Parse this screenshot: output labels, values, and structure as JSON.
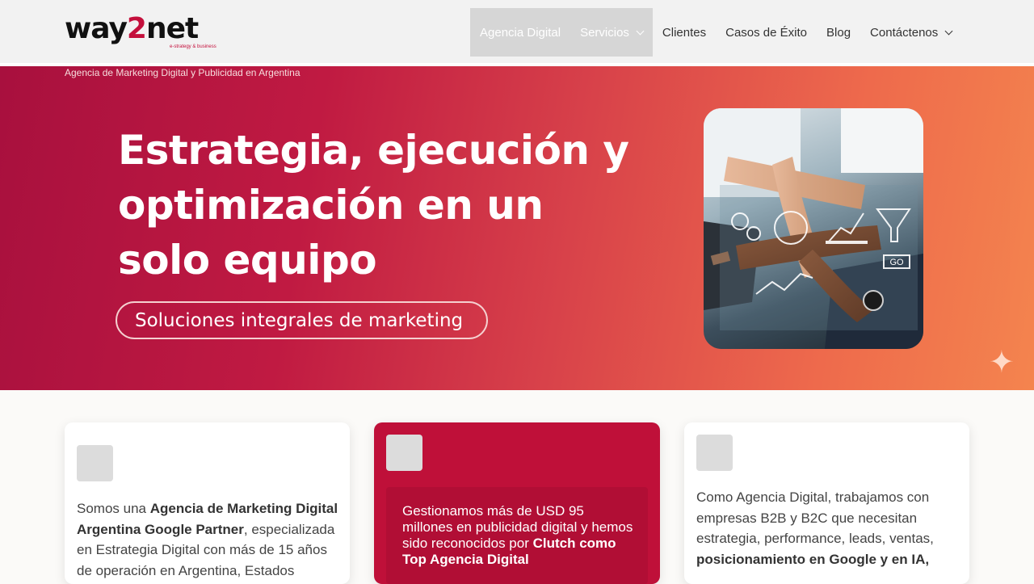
{
  "header": {
    "logo": {
      "word_before": "way",
      "word_two": "2",
      "word_after": "net",
      "tagline": "e-strategy & business"
    },
    "nav": [
      {
        "label": "Agencia Digital"
      },
      {
        "label": "Servicios"
      },
      {
        "label": "Clientes"
      },
      {
        "label": "Casos de Éxito"
      },
      {
        "label": "Blog"
      },
      {
        "label": "Contáctenos"
      }
    ]
  },
  "hero": {
    "breadcrumb": "Agencia de Marketing Digital y Publicidad en Argentina",
    "headline": "Estrategia, ejecución y optimización en un solo equipo",
    "pill": "Soluciones integrales de marketing",
    "photo_panel": "GO"
  },
  "cards": {
    "card1": {
      "t1": "Somos una ",
      "b1": "Agencia de Marketing Digital Argentina Google Partner",
      "t2": ", especializada en Estrategia Digital con más de 15 años de operación en Argentina, Estados"
    },
    "card2": {
      "t1": "Gestionamos más de USD 95 millones en publicidad digital y hemos sido reconocidos por ",
      "b1": "Clutch como Top Agencia Digital"
    },
    "card3": {
      "t1": "Como Agencia Digital, trabajamos con empresas B2B y B2C que necesitan estrategia, performance, leads, ventas, ",
      "b1": "posicionamiento en Google y en IA,"
    }
  },
  "colors": {
    "brand": "#c4103c",
    "card_accent": "#bf1039",
    "nav_active_bg": "#d6d6d6"
  }
}
